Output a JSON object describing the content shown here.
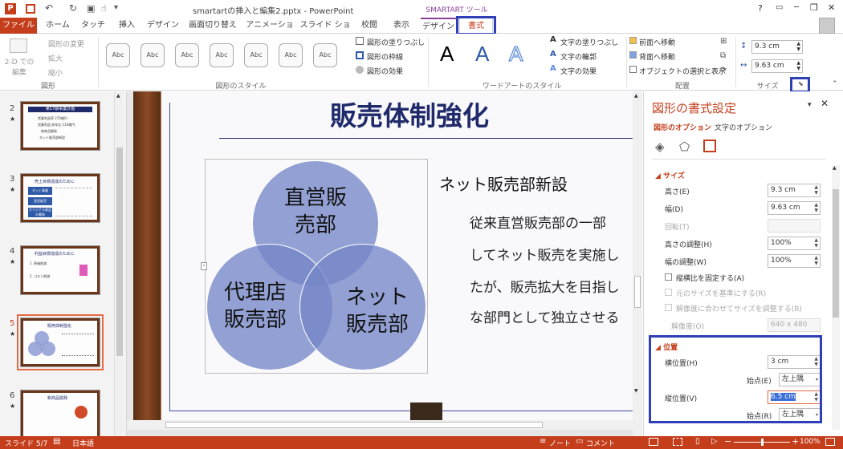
{
  "app": {
    "title": "smartartの挿入と編集2.pptx - PowerPoint",
    "context_tab_group": "SMARTART ツール",
    "help": "?",
    "minimize": "─",
    "restore": "❐",
    "close": "✕"
  },
  "tabs": [
    "ファイル",
    "ホーム",
    "タッチ",
    "挿入",
    "デザイン",
    "画面切り替え",
    "アニメーション",
    "スライド ショー",
    "校閲",
    "表示",
    "デザイン",
    "書式"
  ],
  "ribbon": {
    "shapes_group": {
      "label": "図形",
      "btn_2d": "2-D での\n編集",
      "change_shape": "図形の変更",
      "enlarge": "拡大",
      "shrink": "縮小"
    },
    "shape_styles": {
      "label": "図形のスタイル",
      "thumb": "Abc",
      "fill": "図形の塗りつぶし",
      "outline": "図形の枠線",
      "effects": "図形の効果"
    },
    "wordart": {
      "label": "ワードアートのスタイル",
      "letter": "A",
      "text_fill": "文字の塗りつぶし",
      "text_outline": "文字の輪郭",
      "text_effects": "文字の効果"
    },
    "arrange": {
      "label": "配置",
      "bring_forward": "前面へ移動",
      "send_backward": "背面へ移動",
      "selection_pane": "オブジェクトの選択と表示"
    },
    "size": {
      "label": "サイズ",
      "height": "9.3 cm",
      "width": "9.63 cm"
    }
  },
  "thumbnails": [
    {
      "num": "2",
      "title": "第17期事業計画",
      "lines": [
        "営業利益率 270億円",
        "営業利益 前年比 110億円",
        "新商品開発",
        "ネット販売部新設"
      ]
    },
    {
      "num": "3",
      "title": "売上目標達成のために",
      "lines": [
        "ネット事業",
        "直営販売",
        "オリジナル商品の開発"
      ]
    },
    {
      "num": "4",
      "title": "利益目標達成のために",
      "lines": [
        "1. 原価削減",
        "2. コスト削減"
      ]
    },
    {
      "num": "5",
      "title": "販売体制強化",
      "lines": [
        "直営販売部",
        "代理店販売部",
        "ネット販売部"
      ]
    },
    {
      "num": "6",
      "title": "新商品開発",
      "lines": []
    }
  ],
  "slide": {
    "title": "販売体制強化",
    "circles": [
      "直営販\n売部",
      "代理店\n販売部",
      "ネット\n販売部"
    ],
    "heading": "ネット販売部新設",
    "body": [
      "従来直営販売部の一部",
      "してネット販売を実施し",
      "たが、販売拡大を目指し",
      "な部門として独立させる"
    ]
  },
  "panel": {
    "title": "図形の書式設定",
    "tab_shape": "図形のオプション",
    "tab_text": "文字のオプション",
    "size_section": "サイズ",
    "height_label": "高さ(E)",
    "height_val": "9.3 cm",
    "width_label": "幅(D)",
    "width_val": "9.63 cm",
    "rotation_label": "回転(T)",
    "scale_h_label": "高さの調整(H)",
    "scale_h_val": "100%",
    "scale_w_label": "幅の調整(W)",
    "scale_w_val": "100%",
    "lock_aspect": "縦横比を固定する(A)",
    "relative_original": "元のサイズを基準にする(R)",
    "best_scale": "解像度に合わせてサイズを調整する(B)",
    "resolution_label": "解像度(O)",
    "resolution_val": "640 x 480",
    "position_section": "位置",
    "hpos_label": "横位置(H)",
    "hpos_val": "3 cm",
    "from_label1": "始点(E)",
    "from_val1": "左上隅",
    "vpos_label": "縦位置(V)",
    "vpos_val": "6.5 cm",
    "from_label2": "始点(R)",
    "from_val2": "左上隅"
  },
  "status": {
    "slide": "スライド 5/7",
    "language": "日本語",
    "notes": "ノート",
    "comments": "コメント",
    "zoom": "100%",
    "zoom_fraction": 0.5
  },
  "colors": {
    "accent": "#c43e1c",
    "highlight": "#2f3fb6",
    "slide_title": "#1f2a6b",
    "circle": "#8d9bd3"
  }
}
